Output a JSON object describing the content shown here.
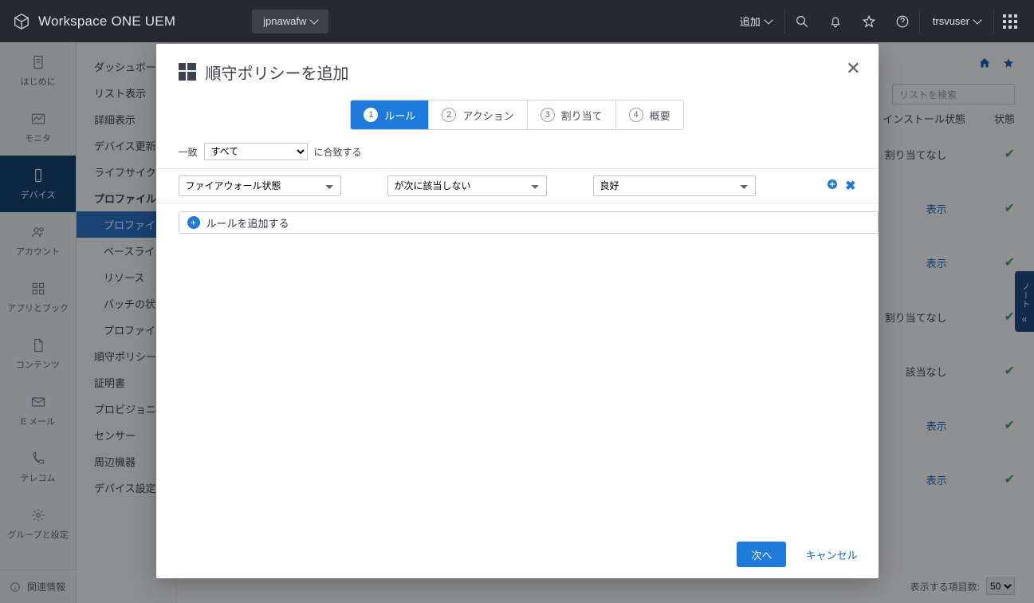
{
  "topbar": {
    "product": "Workspace ONE UEM",
    "tenant": "jpnawafw",
    "add_label": "追加",
    "user": "trsvuser"
  },
  "rail": {
    "items": [
      {
        "label": "はじめに"
      },
      {
        "label": "モニタ"
      },
      {
        "label": "デバイス"
      },
      {
        "label": "アカウント"
      },
      {
        "label": "アプリとブック"
      },
      {
        "label": "コンテンツ"
      },
      {
        "label": "E メール"
      },
      {
        "label": "テレコム"
      },
      {
        "label": "グループと設定"
      }
    ],
    "footer": "関連情報"
  },
  "nav2": {
    "items": [
      {
        "label": "ダッシュボード"
      },
      {
        "label": "リスト表示"
      },
      {
        "label": "詳細表示"
      },
      {
        "label": "デバイス更新"
      },
      {
        "label": "ライフサイクル"
      },
      {
        "label": "プロファイルとリソース",
        "bold": true
      },
      {
        "label": "プロファイル",
        "active": true,
        "lvl2": true
      },
      {
        "label": "ベースライン",
        "lvl2": true
      },
      {
        "label": "リソース",
        "lvl2": true
      },
      {
        "label": "バッチの状態",
        "lvl2": true
      },
      {
        "label": "プロファイル設定",
        "lvl2": true
      },
      {
        "label": "順守ポリシー"
      },
      {
        "label": "証明書"
      },
      {
        "label": "プロビジョニング"
      },
      {
        "label": "センサー"
      },
      {
        "label": "周辺機器"
      },
      {
        "label": "デバイス設定"
      }
    ]
  },
  "workspace": {
    "search_placeholder": "リストを検索",
    "col_install": "インストール状態",
    "col_status": "状態",
    "rows": [
      {
        "install": "割り当てなし"
      },
      {
        "install": "表示"
      },
      {
        "install": "表示"
      },
      {
        "install": "割り当てなし"
      },
      {
        "install": "該当なし"
      },
      {
        "install": "表示"
      },
      {
        "install": "表示"
      }
    ],
    "footer_label": "表示する項目数:",
    "footer_value": "50"
  },
  "modal": {
    "title": "順守ポリシーを追加",
    "wizard": [
      {
        "num": "1",
        "label": "ルール"
      },
      {
        "num": "2",
        "label": "アクション"
      },
      {
        "num": "3",
        "label": "割り当て"
      },
      {
        "num": "4",
        "label": "概要"
      }
    ],
    "match_pre": "一致",
    "match_select": "すべて",
    "match_post": "に合致する",
    "rule": {
      "field": "ファイアウォール状態",
      "op": "が次に該当しない",
      "value": "良好"
    },
    "add_rule": "ルールを追加する",
    "next": "次へ",
    "cancel": "キャンセル"
  },
  "side_tab": "ノート"
}
